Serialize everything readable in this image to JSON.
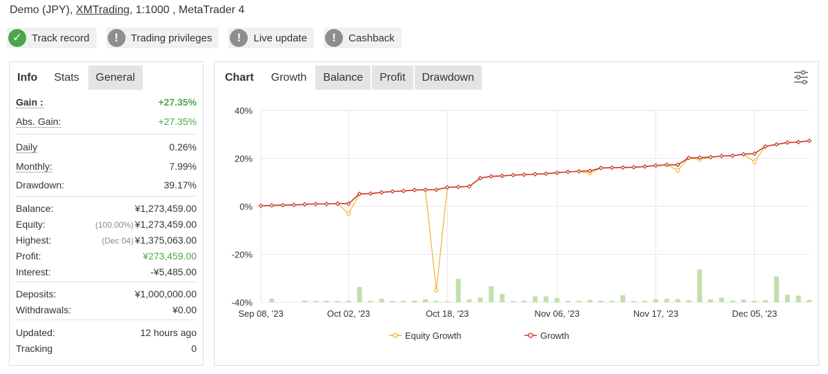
{
  "header": {
    "prefix": "Demo (JPY),",
    "broker": "XMTrading",
    "suffix": ", 1:1000 , MetaTrader 4"
  },
  "badges": [
    {
      "label": "Track record",
      "status": "ok"
    },
    {
      "label": "Trading privileges",
      "status": "warn"
    },
    {
      "label": "Live update",
      "status": "warn"
    },
    {
      "label": "Cashback",
      "status": "warn"
    }
  ],
  "left_tabs": [
    "Info",
    "Stats",
    "General"
  ],
  "stats": {
    "gain": {
      "label": "Gain :",
      "value": "+27.35%"
    },
    "abs_gain": {
      "label": "Abs. Gain:",
      "value": "+27.35%"
    },
    "daily": {
      "label": "Daily",
      "value": "0.26%"
    },
    "monthly": {
      "label": "Monthly:",
      "value": "7.99%"
    },
    "drawdown": {
      "label": "Drawdown:",
      "value": "39.17%"
    },
    "balance": {
      "label": "Balance:",
      "value": "¥1,273,459.00"
    },
    "equity": {
      "label": "Equity:",
      "sub": "(100.00%)",
      "value": "¥1,273,459.00"
    },
    "highest": {
      "label": "Highest:",
      "sub": "(Dec 04)",
      "value": "¥1,375,063.00"
    },
    "profit": {
      "label": "Profit:",
      "value": "¥273,459.00"
    },
    "interest": {
      "label": "Interest:",
      "value": "-¥5,485.00"
    },
    "deposits": {
      "label": "Deposits:",
      "value": "¥1,000,000.00"
    },
    "withdrawals": {
      "label": "Withdrawals:",
      "value": "¥0.00"
    },
    "updated": {
      "label": "Updated:",
      "value": "12 hours ago"
    },
    "tracking": {
      "label": "Tracking",
      "value": "0"
    }
  },
  "right_tabs": [
    "Chart",
    "Growth",
    "Balance",
    "Profit",
    "Drawdown"
  ],
  "colors": {
    "growth": "#c9341f",
    "equity": "#f0b429",
    "bars": "#bfe0ab",
    "green": "#4aa64a"
  },
  "chart_data": {
    "type": "line",
    "ylim": [
      -40,
      40
    ],
    "yticks": [
      "40%",
      "20%",
      "0%",
      "-20%",
      "-40%"
    ],
    "ytick_values": [
      40,
      20,
      0,
      -20,
      -40
    ],
    "xticks": [
      "Sep 08, '23",
      "Oct 02, '23",
      "Oct 18, '23",
      "Nov 06, '23",
      "Nov 17, '23",
      "Dec 05, '23"
    ],
    "xtick_index": [
      0,
      8,
      17,
      27,
      36,
      45
    ],
    "series": [
      {
        "name": "Equity Growth",
        "values": [
          0.2,
          0.4,
          0.5,
          0.6,
          0.8,
          1.0,
          1.0,
          1.1,
          -3,
          5.2,
          5.3,
          5.8,
          6.2,
          6.4,
          6.8,
          6.9,
          -35,
          7.9,
          8.1,
          8.3,
          11.8,
          12.5,
          12.7,
          13.0,
          13.2,
          13.4,
          13.6,
          14.0,
          14.4,
          14.6,
          13.8,
          16.0,
          16.1,
          16.2,
          16.3,
          16.6,
          17.0,
          17.3,
          15,
          20.2,
          19.5,
          20.5,
          21.0,
          21.1,
          21.7,
          18.6,
          25.0,
          25.8,
          26.6,
          26.8,
          27.35
        ]
      },
      {
        "name": "Growth",
        "values": [
          0.2,
          0.4,
          0.5,
          0.6,
          0.8,
          1.0,
          1.0,
          1.1,
          1.1,
          5.2,
          5.3,
          5.8,
          6.2,
          6.4,
          6.8,
          6.9,
          6.9,
          7.9,
          8.1,
          8.3,
          11.8,
          12.5,
          12.7,
          13.0,
          13.2,
          13.4,
          13.6,
          14.0,
          14.4,
          14.6,
          14.8,
          16.0,
          16.1,
          16.2,
          16.3,
          16.6,
          17.0,
          17.3,
          17.3,
          20.2,
          20.3,
          20.5,
          21.0,
          21.1,
          21.7,
          22.0,
          25.0,
          25.8,
          26.6,
          26.8,
          27.35
        ]
      }
    ],
    "bars": [
      0,
      1.5,
      0,
      0,
      0.7,
      0.5,
      0.6,
      0.5,
      0.6,
      6.5,
      0.6,
      1.5,
      0.6,
      0.6,
      0.7,
      1.3,
      0.6,
      0.4,
      10,
      1.2,
      2.0,
      6.8,
      3.5,
      0.5,
      0.7,
      2.5,
      2.5,
      1.8,
      0.6,
      0.6,
      1.0,
      0.6,
      0.6,
      3.0,
      0.5,
      0.6,
      1.3,
      1.5,
      1.3,
      0.8,
      14,
      1.2,
      2.0,
      0.7,
      1.2,
      0.6,
      0.9,
      11,
      3.2,
      2.8,
      1.0,
      1.1
    ]
  }
}
